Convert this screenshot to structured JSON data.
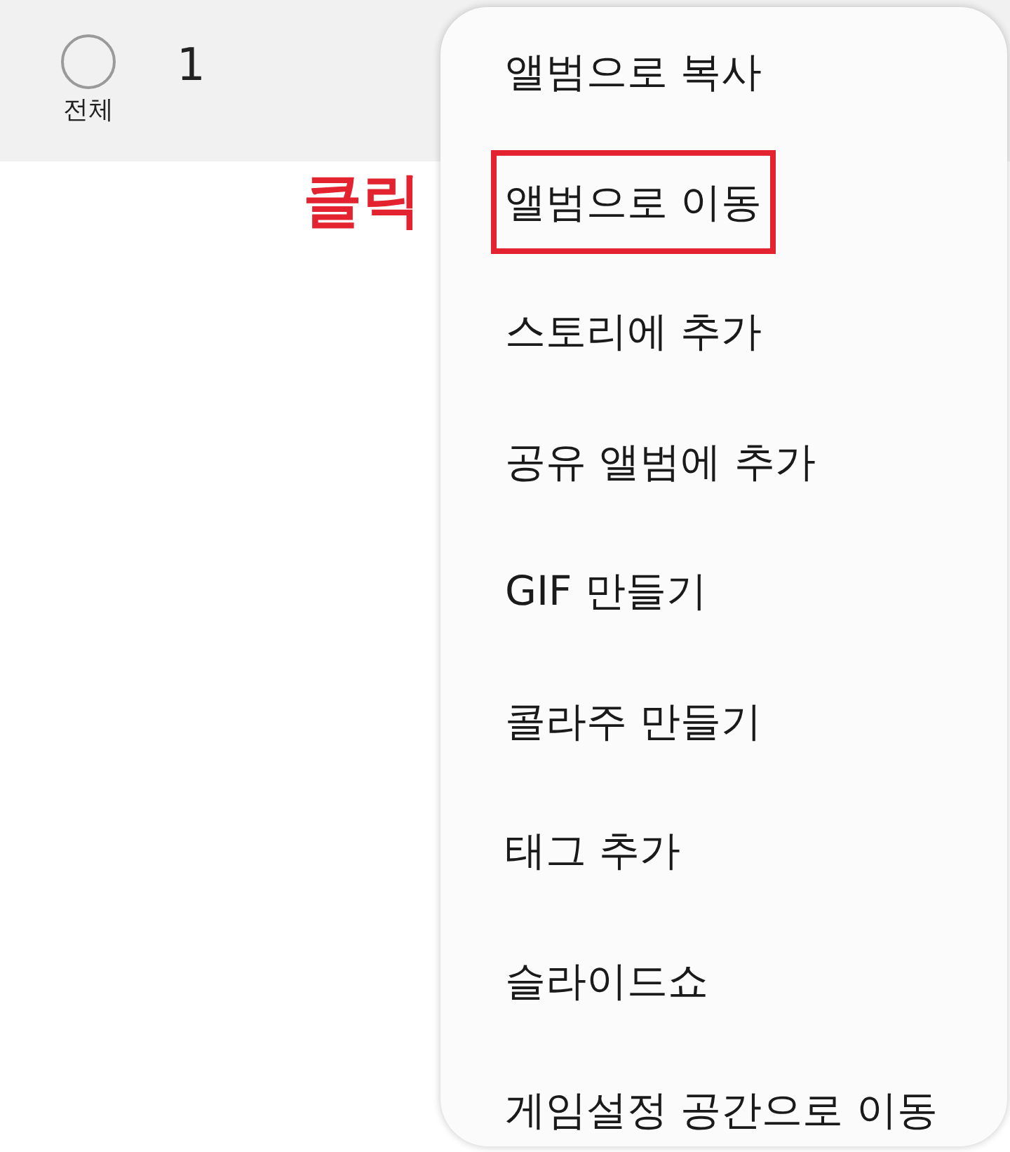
{
  "selection_bar": {
    "select_all": {
      "label": "전체",
      "checked": false
    },
    "count": "1"
  },
  "annotation": {
    "label": "클릭"
  },
  "menu": {
    "items": [
      {
        "label": "앨범으로 복사",
        "highlighted": false
      },
      {
        "label": "앨범으로 이동",
        "highlighted": true
      },
      {
        "label": "스토리에 추가",
        "highlighted": false
      },
      {
        "label": "공유 앨범에 추가",
        "highlighted": false
      },
      {
        "label": "GIF 만들기",
        "highlighted": false
      },
      {
        "label": "콜라주 만들기",
        "highlighted": false
      },
      {
        "label": "태그 추가",
        "highlighted": false
      },
      {
        "label": "슬라이드쇼",
        "highlighted": false
      },
      {
        "label": "게임설정 공간으로 이동",
        "highlighted": false
      }
    ]
  }
}
